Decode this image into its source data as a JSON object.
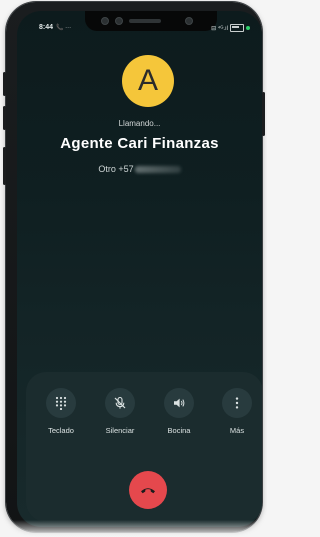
{
  "status_bar": {
    "time": "8:44",
    "left_icons": "📞 ···",
    "right_icons": "⊟ ⁴ᴳ.ıl"
  },
  "call": {
    "avatar_letter": "A",
    "status": "Llamando...",
    "contact_name": "Agente Cari Finanzas",
    "number_prefix": "Otro +57"
  },
  "controls": [
    {
      "label": "Teclado",
      "icon": "dialpad-icon"
    },
    {
      "label": "Silenciar",
      "icon": "mic-off-icon"
    },
    {
      "label": "Bocina",
      "icon": "speaker-icon"
    },
    {
      "label": "Más",
      "icon": "more-vert-icon"
    }
  ],
  "end_call": {
    "icon": "end-call-icon"
  },
  "colors": {
    "avatar": "#f5c63a",
    "end_call": "#e5484d",
    "panel": "#1b2c2e",
    "button": "#283b3e"
  }
}
